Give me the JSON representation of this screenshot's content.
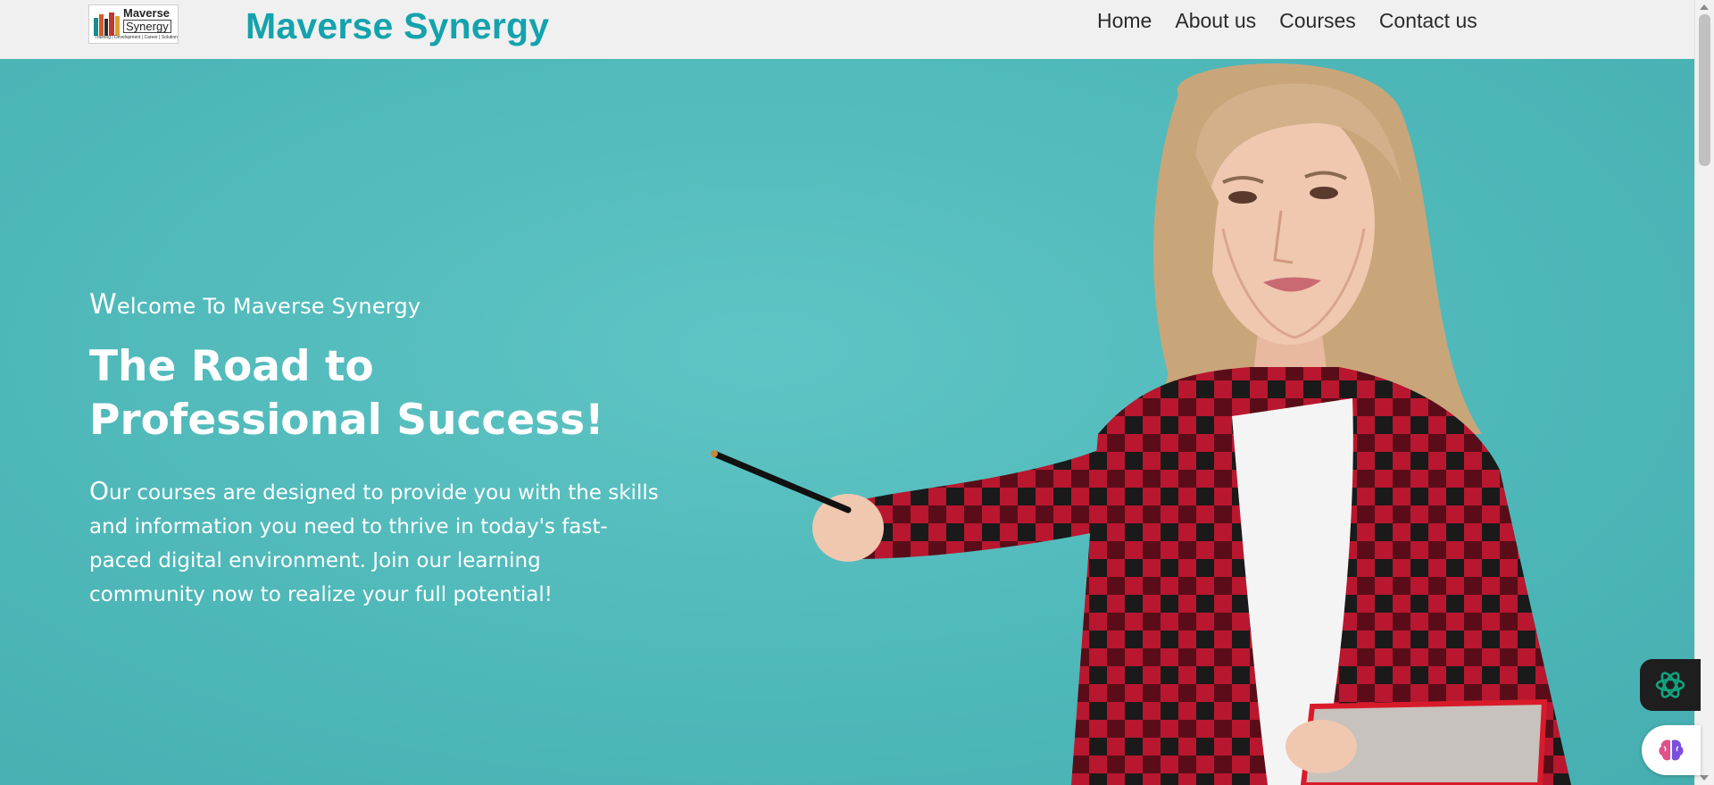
{
  "logo": {
    "line1": "Maverse",
    "line2": "Synergy",
    "tagline": "Training | Development | Career | Solution"
  },
  "brand": {
    "title": "Maverse Synergy"
  },
  "nav": {
    "items": [
      {
        "label": "Home"
      },
      {
        "label": "About us"
      },
      {
        "label": "Courses"
      },
      {
        "label": "Contact us"
      }
    ]
  },
  "hero": {
    "welcome": "Welcome To Maverse Synergy",
    "heading": "The Road to Professional Success!",
    "description": "Our courses are designed to provide you with the skills and information you need to thrive in today's fast-paced digital environment. Join our learning community now to realize your full potential!",
    "background_color": "#4fb8b9"
  },
  "colors": {
    "brand": "#14a3ad",
    "header_bg": "#f0f0f0",
    "hero_text": "#ffffff"
  },
  "widgets": [
    {
      "icon": "openai-logo-icon"
    },
    {
      "icon": "brain-icon"
    }
  ]
}
